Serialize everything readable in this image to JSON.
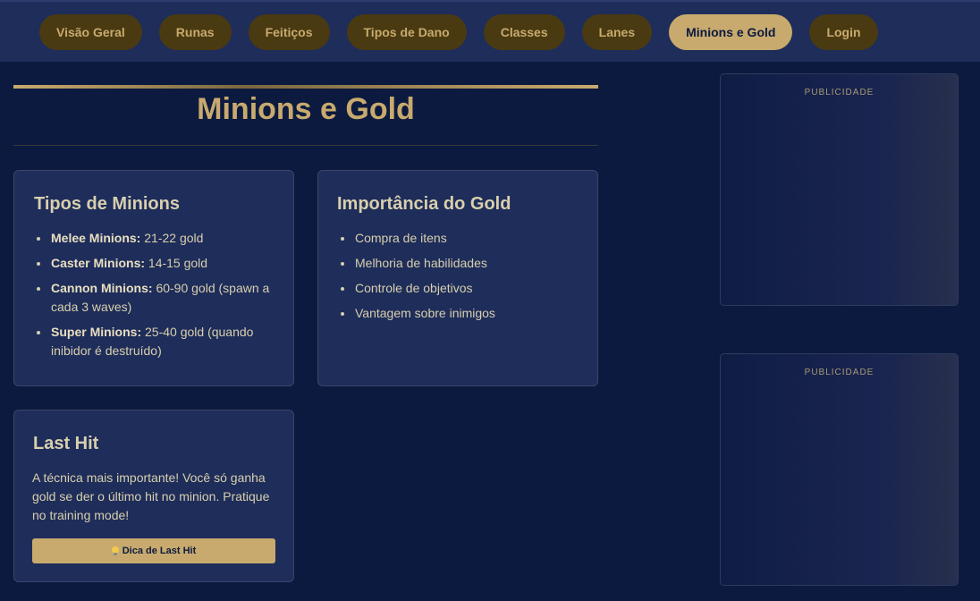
{
  "nav": {
    "items": [
      {
        "label": "Visão Geral"
      },
      {
        "label": "Runas"
      },
      {
        "label": "Feitiços"
      },
      {
        "label": "Tipos de Dano"
      },
      {
        "label": "Classes"
      },
      {
        "label": "Lanes"
      },
      {
        "label": "Minions e Gold"
      },
      {
        "label": "Login"
      }
    ],
    "active": "Minions e Gold"
  },
  "page": {
    "title": "Minions e Gold"
  },
  "minion_types": {
    "title": "Tipos de Minions",
    "items": [
      {
        "name": "Melee Minions:",
        "value": "21-22 gold"
      },
      {
        "name": "Caster Minions:",
        "value": "14-15 gold"
      },
      {
        "name": "Cannon Minions:",
        "value": "60-90 gold (spawn a cada 3 waves)"
      },
      {
        "name": "Super Minions:",
        "value": "25-40 gold (quando inibidor é destruído)"
      }
    ]
  },
  "gold_importance": {
    "title": "Importância do Gold",
    "items": [
      "Compra de itens",
      "Melhoria de habilidades",
      "Controle de objetivos",
      "Vantagem sobre inimigos"
    ]
  },
  "last_hit": {
    "title": "Last Hit",
    "text": "A técnica mais importante! Você só ganha gold se der o último hit no minion. Pratique no training mode!",
    "button_label": "Dica de Last Hit",
    "button_icon": "lightbulb-icon"
  },
  "ads": [
    {
      "label": "PUBLICIDADE"
    },
    {
      "label": "PUBLICIDADE"
    }
  ],
  "colors": {
    "background": "#0c1a3f",
    "card": "#1e2d5a",
    "accent": "#c8aa6e",
    "nav_button": "#4a3a12"
  }
}
